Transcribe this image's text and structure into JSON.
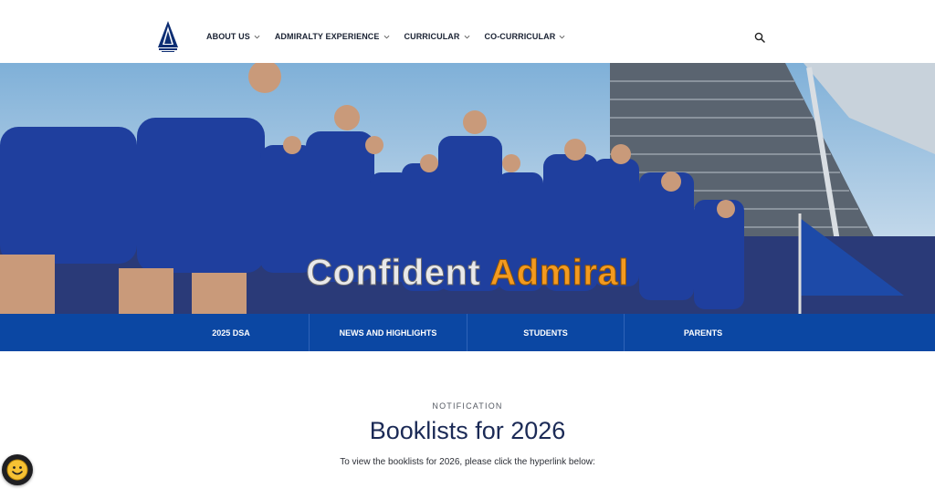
{
  "header": {
    "nav": [
      {
        "label": "ABOUT US"
      },
      {
        "label": "ADMIRALTY EXPERIENCE"
      },
      {
        "label": "CURRICULAR"
      },
      {
        "label": "CO-CURRICULAR"
      }
    ]
  },
  "hero": {
    "caption_part1": "Confident",
    "caption_part2": "Admiral"
  },
  "tabs": [
    {
      "label": "2025 DSA"
    },
    {
      "label": "NEWS AND HIGHLIGHTS"
    },
    {
      "label": "STUDENTS"
    },
    {
      "label": "PARENTS"
    }
  ],
  "notice": {
    "eyebrow": "NOTIFICATION",
    "title": "Booklists for 2026",
    "description": "To view the booklists for 2026, please click the hyperlink below:"
  },
  "colors": {
    "brand_blue": "#0b47a3",
    "title_navy": "#1b2a56",
    "caption_orange": "#f39a1f"
  },
  "icons": {
    "logo": "admiralty-crest-icon",
    "search": "search-icon",
    "chevron": "chevron-down-icon",
    "help": "smiley-chat-icon"
  }
}
